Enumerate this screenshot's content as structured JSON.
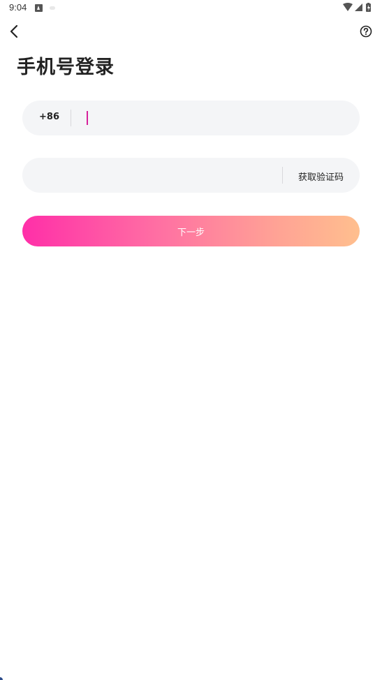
{
  "status_bar": {
    "time": "9:04"
  },
  "nav": {
    "back_icon": "chevron-left-icon",
    "help_icon": "question-circle-icon"
  },
  "page": {
    "title": "手机号登录"
  },
  "phone_field": {
    "country_code": "+86",
    "value": "",
    "placeholder": ""
  },
  "code_field": {
    "value": "",
    "placeholder": "",
    "get_code_label": "获取验证码"
  },
  "next_button": {
    "label": "下一步"
  },
  "colors": {
    "accent": "#d6219b",
    "button_gradient_start": "#ff2fa8",
    "button_gradient_end": "#ffbf8e",
    "field_background": "#f4f5f7"
  }
}
